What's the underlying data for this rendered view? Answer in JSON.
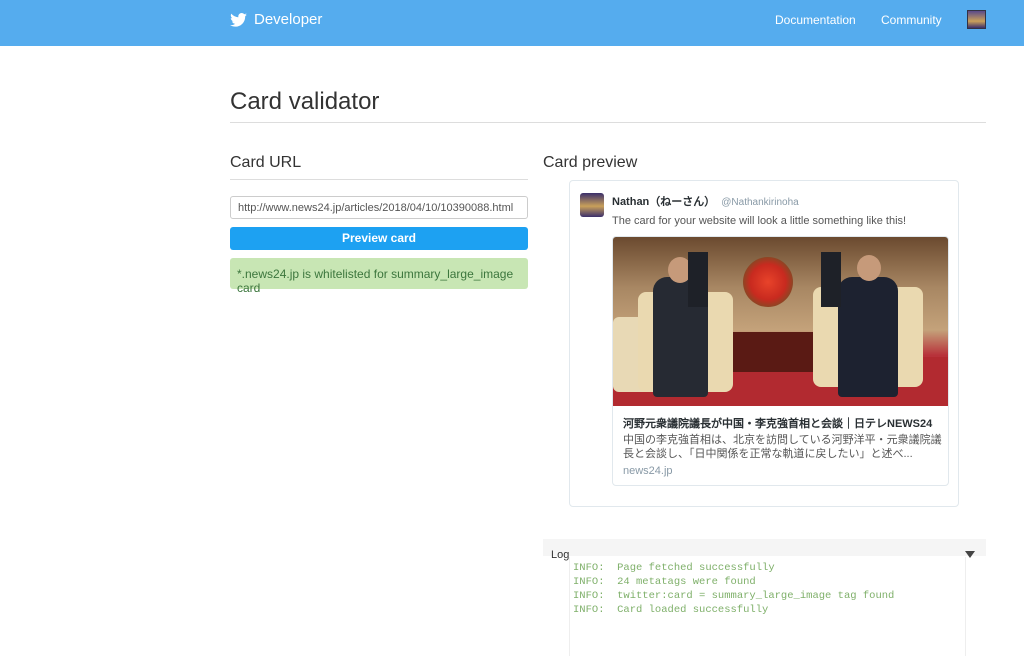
{
  "header": {
    "brand": "Developer",
    "nav": [
      "Documentation",
      "Community"
    ],
    "brand_color": "#55acee"
  },
  "page": {
    "title": "Card validator"
  },
  "form": {
    "heading": "Card URL",
    "url_value": "http://www.news24.jp/articles/2018/04/10/10390088.html",
    "button": "Preview card",
    "status": "*.news24.jp is whitelisted for summary_large_image card"
  },
  "preview": {
    "heading": "Card preview",
    "tweet": {
      "name": "Nathan（ねーさん）",
      "handle": "@Nathankirinoha",
      "text": "The card for your website will look a little something like this!"
    },
    "card": {
      "title": "河野元衆議院議長が中国・李克強首相と会談｜日テレNEWS24",
      "description": "中国の李克強首相は、北京を訪問している河野洋平・元衆議院議長と会談し、「日中関係を正常な軌道に戻したい」と述べ...",
      "domain": "news24.jp"
    }
  },
  "log": {
    "label": "Log",
    "lines": [
      "INFO:  Page fetched successfully",
      "INFO:  24 metatags were found",
      "INFO:  twitter:card = summary_large_image tag found",
      "INFO:  Card loaded successfully"
    ]
  }
}
